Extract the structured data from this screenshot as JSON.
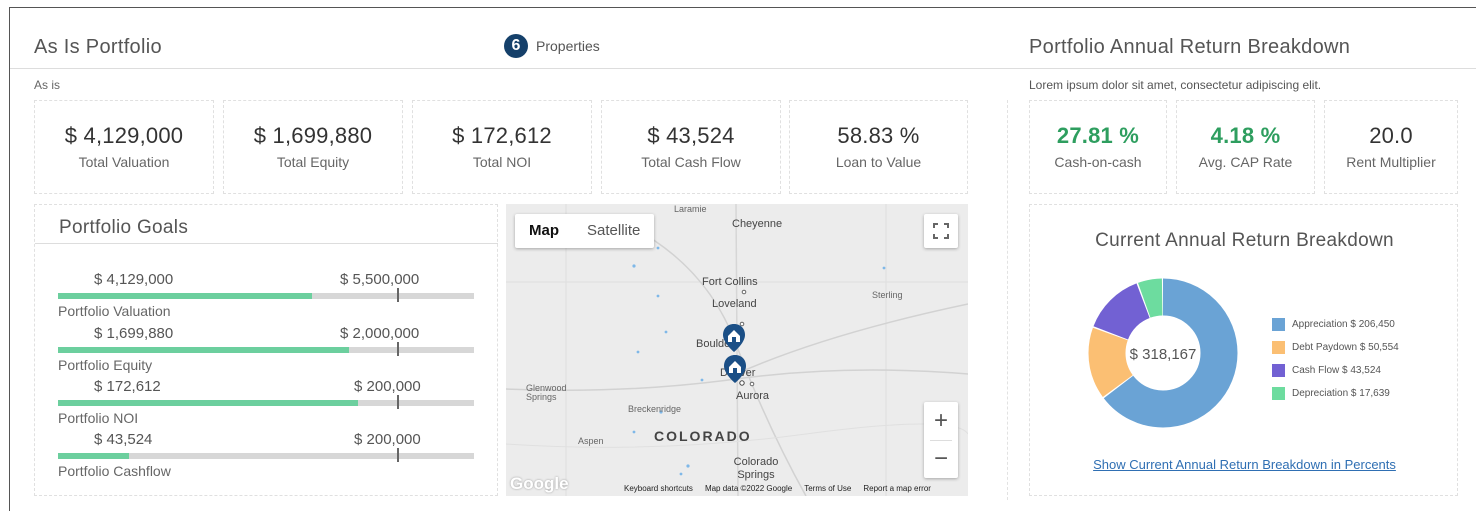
{
  "header": {
    "title": "As Is Portfolio",
    "properties_count": "6",
    "properties_label": "Properties",
    "subtitle": "As is",
    "right_title": "Portfolio Annual Return Breakdown",
    "right_subtitle": "Lorem ipsum dolor sit amet, consectetur adipiscing elit."
  },
  "stats": [
    {
      "value": "$ 4,129,000",
      "label": "Total Valuation"
    },
    {
      "value": "$ 1,699,880",
      "label": "Total Equity"
    },
    {
      "value": "$ 172,612",
      "label": "Total NOI"
    },
    {
      "value": "$ 43,524",
      "label": "Total Cash Flow"
    },
    {
      "value": "58.83 %",
      "label": "Loan to Value"
    }
  ],
  "right_stats": [
    {
      "value": "27.81 %",
      "label": "Cash-on-cash"
    },
    {
      "value": "4.18 %",
      "label": "Avg. CAP Rate"
    },
    {
      "value": "20.0",
      "label": "Rent Multiplier"
    }
  ],
  "goals": {
    "title": "Portfolio Goals",
    "items": [
      {
        "current": "$ 4,129,000",
        "target": "$ 5,500,000",
        "name": "Portfolio Valuation",
        "progress": 0.61
      },
      {
        "current": "$ 1,699,880",
        "target": "$ 2,000,000",
        "name": "Portfolio Equity",
        "progress": 0.7
      },
      {
        "current": "$ 172,612",
        "target": "$ 200,000",
        "name": "Portfolio NOI",
        "progress": 0.72
      },
      {
        "current": "$ 43,524",
        "target": "$ 200,000",
        "name": "Portfolio Cashflow",
        "progress": 0.17
      }
    ]
  },
  "map": {
    "tabs": {
      "map": "Map",
      "satellite": "Satellite"
    },
    "labels": {
      "laramie": "Laramie",
      "cheyenne": "Cheyenne",
      "fort_collins": "Fort Collins",
      "loveland": "Loveland",
      "sterling": "Sterling",
      "boulder": "Boulder",
      "denver": "Denver",
      "aurora": "Aurora",
      "glenwood": "Glenwood Springs",
      "breckenridge": "Breckenridge",
      "aspen": "Aspen",
      "colorado": "COLORADO",
      "colorado_springs": "Colorado Springs"
    },
    "zoom_in": "+",
    "zoom_out": "−",
    "google": "Google",
    "footer": {
      "shortcuts": "Keyboard shortcuts",
      "data": "Map data ©2022 Google",
      "terms": "Terms of Use",
      "report": "Report a map error"
    }
  },
  "donut": {
    "title": "Current Annual Return Breakdown",
    "center_label": "$ 318,167",
    "link": "Show Current Annual Return Breakdown in Percents"
  },
  "chart_data": {
    "type": "pie",
    "title": "Current Annual Return Breakdown",
    "categories": [
      "Appreciation",
      "Debt Paydown",
      "Cash Flow",
      "Depreciation"
    ],
    "values": [
      206450,
      50554,
      43524,
      17639
    ],
    "legend_labels": [
      "Appreciation $ 206,450",
      "Debt Paydown $ 50,554",
      "Cash Flow $ 43,524",
      "Depreciation $ 17,639"
    ],
    "colors": [
      "#6aa3d5",
      "#fbbf73",
      "#7261d3",
      "#6ddc9f"
    ],
    "center": "$ 318,167",
    "legend_position": "right"
  }
}
